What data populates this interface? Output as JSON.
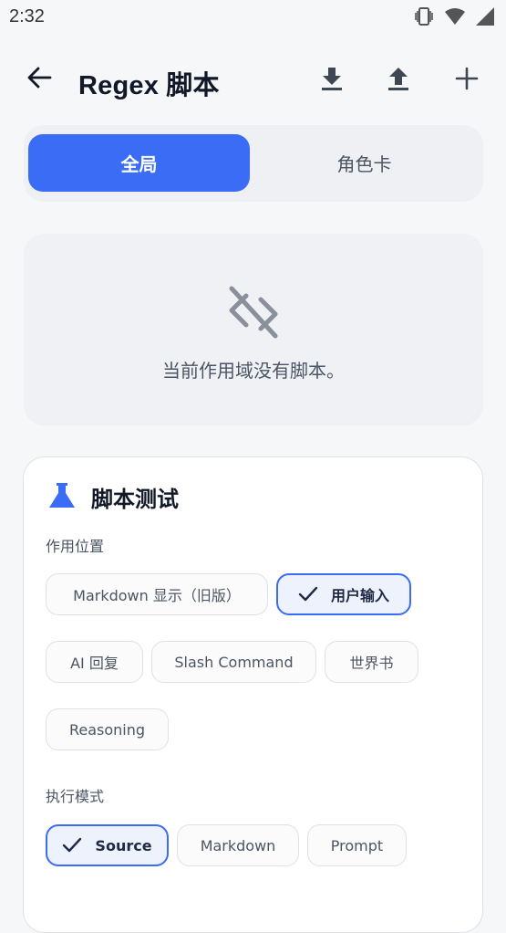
{
  "status_bar": {
    "time": "2:32",
    "icons": [
      "vibrate-icon",
      "wifi-icon",
      "cell-signal-icon"
    ]
  },
  "app_bar": {
    "title": "Regex 脚本",
    "actions": [
      "download-icon",
      "upload-icon",
      "add-icon"
    ]
  },
  "tabs": [
    {
      "label": "全局",
      "active": true
    },
    {
      "label": "角色卡",
      "active": false
    }
  ],
  "empty_state": {
    "icon": "link-off-icon",
    "message": "当前作用域没有脚本。"
  },
  "test_panel": {
    "title": "脚本测试",
    "icon": "flask-icon",
    "position_label": "作用位置",
    "positions": [
      {
        "label": "Markdown 显示（旧版）",
        "selected": false
      },
      {
        "label": "用户输入",
        "selected": true
      },
      {
        "label": "AI 回复",
        "selected": false
      },
      {
        "label": "Slash Command",
        "selected": false
      },
      {
        "label": "世界书",
        "selected": false
      },
      {
        "label": "Reasoning",
        "selected": false
      }
    ],
    "mode_label": "执行模式",
    "modes": [
      {
        "label": "Source",
        "selected": true
      },
      {
        "label": "Markdown",
        "selected": false
      },
      {
        "label": "Prompt",
        "selected": false
      }
    ]
  },
  "colors": {
    "accent": "#3b6cf6",
    "background": "#f6f7f9",
    "card": "#ffffff"
  }
}
